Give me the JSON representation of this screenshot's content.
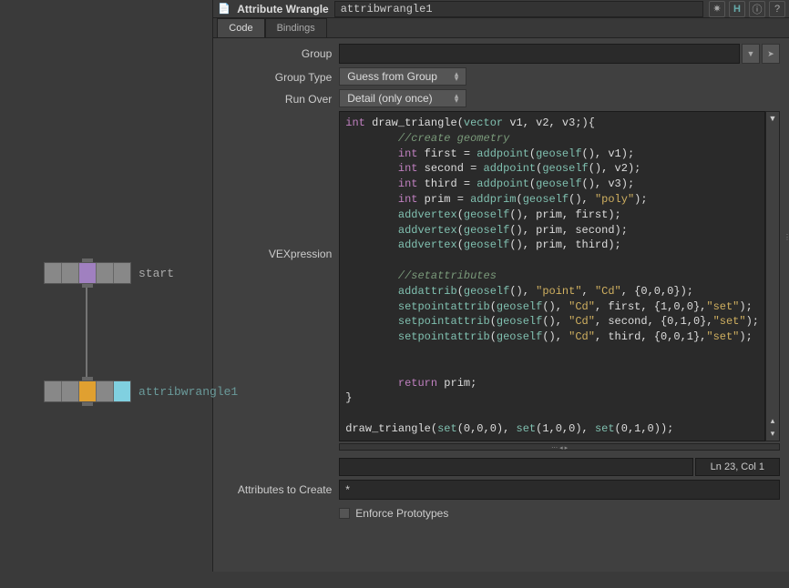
{
  "header": {
    "node_type": "Attribute Wrangle",
    "node_name": "attribwrangle1"
  },
  "tabs": [
    "Code",
    "Bindings"
  ],
  "active_tab": 0,
  "params": {
    "group_label": "Group",
    "group_value": "",
    "group_type_label": "Group Type",
    "group_type_value": "Guess from Group",
    "run_over_label": "Run Over",
    "run_over_value": "Detail (only once)",
    "vex_label": "VEXpression",
    "attrs_label": "Attributes to Create",
    "attrs_value": "*",
    "enforce_label": "Enforce Prototypes"
  },
  "status": {
    "lncol": "Ln 23, Col 1"
  },
  "network": {
    "start_label": "start",
    "wrangle_label": "attribwrangle1"
  },
  "code_tokens": [
    [
      [
        "kw",
        "int"
      ],
      [
        "sym",
        " draw_triangle("
      ],
      [
        "type",
        "vector"
      ],
      [
        "sym",
        " v1, v2, v3;){"
      ]
    ],
    [
      [
        "sym",
        "        "
      ],
      [
        "cm",
        "//create geometry"
      ]
    ],
    [
      [
        "sym",
        "        "
      ],
      [
        "kw",
        "int"
      ],
      [
        "sym",
        " first = "
      ],
      [
        "fn",
        "addpoint"
      ],
      [
        "sym",
        "("
      ],
      [
        "fn",
        "geoself"
      ],
      [
        "sym",
        "(), v1);"
      ]
    ],
    [
      [
        "sym",
        "        "
      ],
      [
        "kw",
        "int"
      ],
      [
        "sym",
        " second = "
      ],
      [
        "fn",
        "addpoint"
      ],
      [
        "sym",
        "("
      ],
      [
        "fn",
        "geoself"
      ],
      [
        "sym",
        "(), v2);"
      ]
    ],
    [
      [
        "sym",
        "        "
      ],
      [
        "kw",
        "int"
      ],
      [
        "sym",
        " third = "
      ],
      [
        "fn",
        "addpoint"
      ],
      [
        "sym",
        "("
      ],
      [
        "fn",
        "geoself"
      ],
      [
        "sym",
        "(), v3);"
      ]
    ],
    [
      [
        "sym",
        "        "
      ],
      [
        "kw",
        "int"
      ],
      [
        "sym",
        " prim = "
      ],
      [
        "fn",
        "addprim"
      ],
      [
        "sym",
        "("
      ],
      [
        "fn",
        "geoself"
      ],
      [
        "sym",
        "(), "
      ],
      [
        "str",
        "\"poly\""
      ],
      [
        "sym",
        ");"
      ]
    ],
    [
      [
        "sym",
        "        "
      ],
      [
        "fn",
        "addvertex"
      ],
      [
        "sym",
        "("
      ],
      [
        "fn",
        "geoself"
      ],
      [
        "sym",
        "(), prim, first);"
      ]
    ],
    [
      [
        "sym",
        "        "
      ],
      [
        "fn",
        "addvertex"
      ],
      [
        "sym",
        "("
      ],
      [
        "fn",
        "geoself"
      ],
      [
        "sym",
        "(), prim, second);"
      ]
    ],
    [
      [
        "sym",
        "        "
      ],
      [
        "fn",
        "addvertex"
      ],
      [
        "sym",
        "("
      ],
      [
        "fn",
        "geoself"
      ],
      [
        "sym",
        "(), prim, third);"
      ]
    ],
    [
      [
        "sym",
        "        "
      ]
    ],
    [
      [
        "sym",
        "        "
      ],
      [
        "cm",
        "//setattributes"
      ]
    ],
    [
      [
        "sym",
        "        "
      ],
      [
        "fn",
        "addattrib"
      ],
      [
        "sym",
        "("
      ],
      [
        "fn",
        "geoself"
      ],
      [
        "sym",
        "(), "
      ],
      [
        "str",
        "\"point\""
      ],
      [
        "sym",
        ", "
      ],
      [
        "str",
        "\"Cd\""
      ],
      [
        "sym",
        ", {0,0,0});"
      ]
    ],
    [
      [
        "sym",
        "        "
      ],
      [
        "fn",
        "setpointattrib"
      ],
      [
        "sym",
        "("
      ],
      [
        "fn",
        "geoself"
      ],
      [
        "sym",
        "(), "
      ],
      [
        "str",
        "\"Cd\""
      ],
      [
        "sym",
        ", first, {1,0,0},"
      ],
      [
        "str",
        "\"set\""
      ],
      [
        "sym",
        ");"
      ]
    ],
    [
      [
        "sym",
        "        "
      ],
      [
        "fn",
        "setpointattrib"
      ],
      [
        "sym",
        "("
      ],
      [
        "fn",
        "geoself"
      ],
      [
        "sym",
        "(), "
      ],
      [
        "str",
        "\"Cd\""
      ],
      [
        "sym",
        ", second, {0,1,0},"
      ],
      [
        "str",
        "\"set\""
      ],
      [
        "sym",
        ");"
      ]
    ],
    [
      [
        "sym",
        "        "
      ],
      [
        "fn",
        "setpointattrib"
      ],
      [
        "sym",
        "("
      ],
      [
        "fn",
        "geoself"
      ],
      [
        "sym",
        "(), "
      ],
      [
        "str",
        "\"Cd\""
      ],
      [
        "sym",
        ", third, {0,0,1},"
      ],
      [
        "str",
        "\"set\""
      ],
      [
        "sym",
        ");"
      ]
    ],
    [
      [
        "sym",
        "        "
      ]
    ],
    [
      [
        "sym",
        "        "
      ]
    ],
    [
      [
        "sym",
        "        "
      ],
      [
        "kw",
        "return"
      ],
      [
        "sym",
        " prim;"
      ]
    ],
    [
      [
        "sym",
        "}"
      ]
    ],
    [
      [
        "sym",
        " "
      ]
    ],
    [
      [
        "sym",
        "draw_triangle("
      ],
      [
        "fn",
        "set"
      ],
      [
        "sym",
        "(0,0,0), "
      ],
      [
        "fn",
        "set"
      ],
      [
        "sym",
        "(1,0,0), "
      ],
      [
        "fn",
        "set"
      ],
      [
        "sym",
        "(0,1,0));"
      ]
    ]
  ]
}
